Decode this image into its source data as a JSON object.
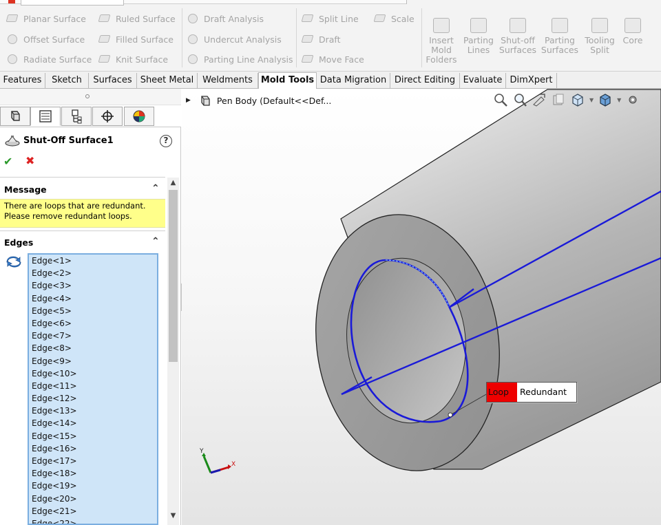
{
  "ribbon": {
    "col1": [
      "Planar Surface",
      "Offset Surface",
      "Radiate Surface"
    ],
    "col2": [
      "Ruled Surface",
      "Filled Surface",
      "Knit Surface"
    ],
    "col3": [
      "Draft Analysis",
      "Undercut Analysis",
      "Parting Line Analysis"
    ],
    "col4": [
      "Split Line",
      "Draft",
      "Move Face"
    ],
    "col5": [
      "Scale"
    ],
    "big": [
      {
        "line1": "Insert",
        "line2": "Mold",
        "line3": "Folders"
      },
      {
        "line1": "Parting",
        "line2": "Lines",
        "line3": ""
      },
      {
        "line1": "Shut-off",
        "line2": "Surfaces",
        "line3": ""
      },
      {
        "line1": "Parting",
        "line2": "Surfaces",
        "line3": ""
      },
      {
        "line1": "Tooling",
        "line2": "Split",
        "line3": ""
      },
      {
        "line1": "Core",
        "line2": "",
        "line3": ""
      }
    ]
  },
  "tabs": [
    "Features",
    "Sketch",
    "Surfaces",
    "Sheet Metal",
    "Weldments",
    "Mold Tools",
    "Data Migration",
    "Direct Editing",
    "Evaluate",
    "DimXpert"
  ],
  "active_tab": "Mold Tools",
  "property_manager": {
    "title": "Shut-Off Surface1",
    "help": "?",
    "message_header": "Message",
    "message_line1": "There are loops that are redundant.",
    "message_line2": "Please remove redundant loops.",
    "edges_header": "Edges",
    "edges": [
      "Edge<1>",
      "Edge<2>",
      "Edge<3>",
      "Edge<4>",
      "Edge<5>",
      "Edge<6>",
      "Edge<7>",
      "Edge<8>",
      "Edge<9>",
      "Edge<10>",
      "Edge<11>",
      "Edge<12>",
      "Edge<13>",
      "Edge<14>",
      "Edge<15>",
      "Edge<16>",
      "Edge<17>",
      "Edge<18>",
      "Edge<19>",
      "Edge<20>",
      "Edge<21>",
      "Edge<22>"
    ]
  },
  "viewport": {
    "tree_label": "Pen Body  (Default<<Def...",
    "callout_key": "Loop",
    "callout_value": "Redundant",
    "triad_y": "Y",
    "triad_x": "X"
  },
  "colors": {
    "loop_line": "#1a1ad8",
    "message_bg": "#ffff8a",
    "callout_key_bg": "#ee0000",
    "list_bg": "#cfe5f8"
  }
}
